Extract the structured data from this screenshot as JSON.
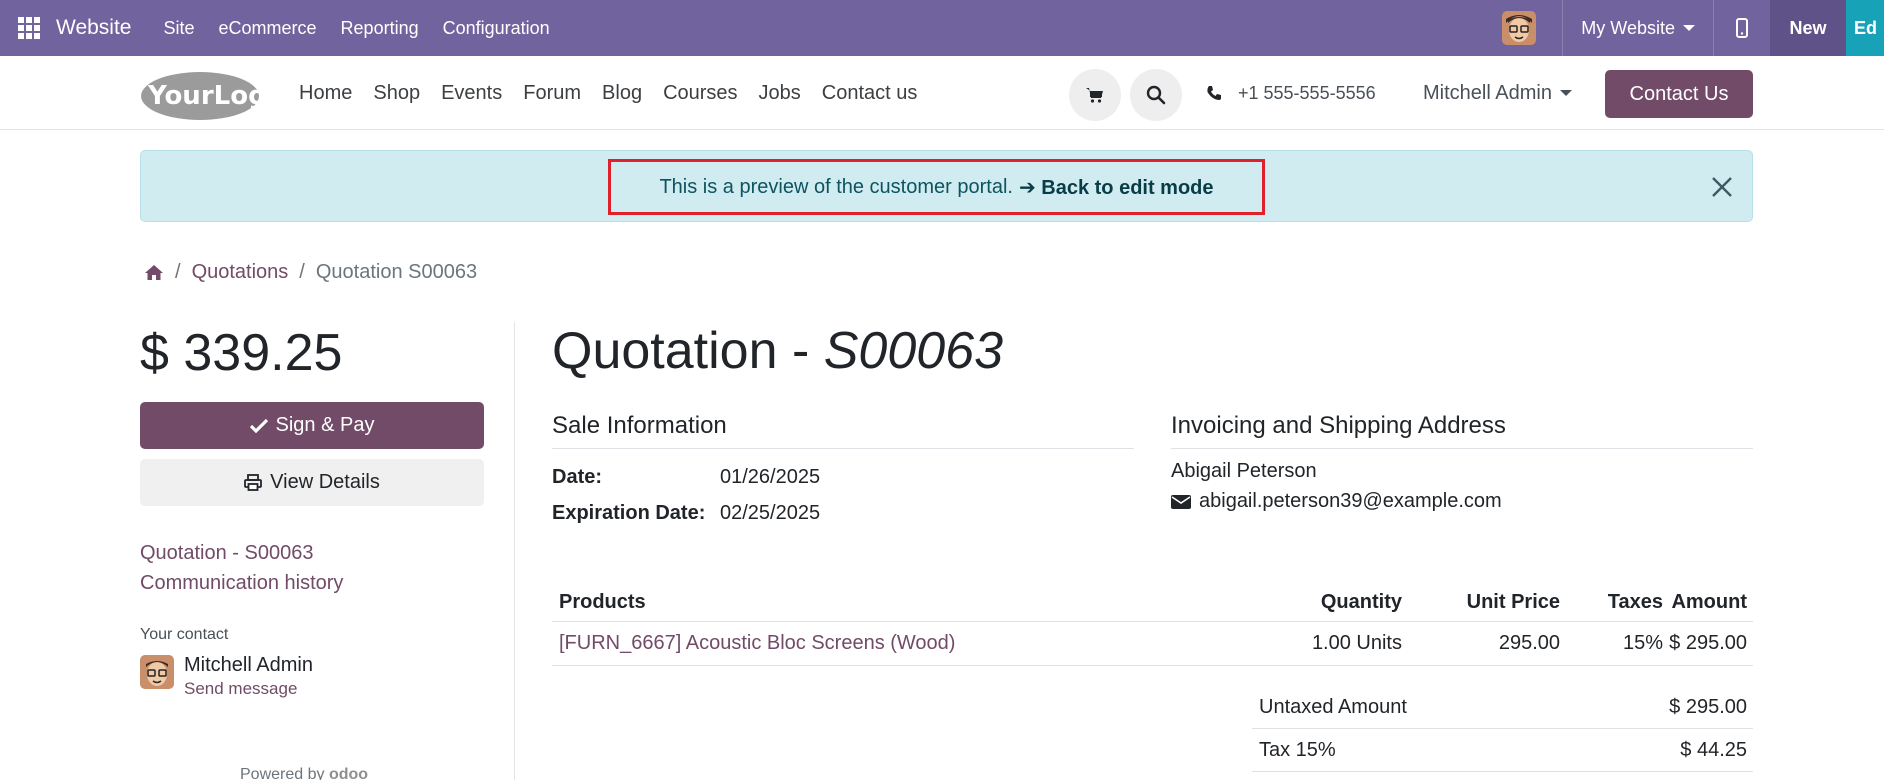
{
  "admin_bar": {
    "brand": "Website",
    "menus": [
      "Site",
      "eCommerce",
      "Reporting",
      "Configuration"
    ],
    "website_selector": "My Website",
    "new_label": "New",
    "edit_label": "Ed"
  },
  "header": {
    "logo_text": "YourLogo",
    "nav": [
      "Home",
      "Shop",
      "Events",
      "Forum",
      "Blog",
      "Courses",
      "Jobs",
      "Contact us"
    ],
    "phone": "+1 555-555-5556",
    "user": "Mitchell Admin",
    "contact_button": "Contact Us"
  },
  "alert": {
    "message": "This is a preview of the customer portal.",
    "link": "➔ Back to edit mode"
  },
  "breadcrumb": {
    "items": [
      "Quotations",
      "Quotation S00063"
    ]
  },
  "sidebar": {
    "total": "$ 339.25",
    "sign_pay": "Sign & Pay",
    "view_details": "View Details",
    "links": [
      "Quotation - S00063",
      "Communication history"
    ],
    "contact_label": "Your contact",
    "contact_name": "Mitchell Admin",
    "send_message": "Send message",
    "powered_by": "Powered by",
    "powered_brand": "odoo"
  },
  "main": {
    "title_prefix": "Quotation - ",
    "title_ref": "S00063",
    "sale_info": {
      "heading": "Sale Information",
      "date_label": "Date:",
      "date_value": "01/26/2025",
      "exp_label": "Expiration Date:",
      "exp_value": "02/25/2025"
    },
    "address": {
      "heading": "Invoicing and Shipping Address",
      "name": "Abigail Peterson",
      "email": "abigail.peterson39@example.com"
    },
    "table": {
      "headers": [
        "Products",
        "Quantity",
        "Unit Price",
        "Taxes",
        "Amount"
      ],
      "rows": [
        [
          "[FURN_6667] Acoustic Bloc Screens (Wood)",
          "1.00 Units",
          "295.00",
          "15%",
          "$ 295.00"
        ]
      ]
    },
    "totals": [
      {
        "label": "Untaxed Amount",
        "value": "$ 295.00"
      },
      {
        "label": "Tax 15%",
        "value": "$ 44.25"
      }
    ]
  },
  "colors": {
    "admin_bar": "#71639e",
    "brand": "#714b67",
    "alert_bg": "#d1ecf1",
    "highlight": "#e0202a",
    "edit_button": "#17a2b8"
  }
}
